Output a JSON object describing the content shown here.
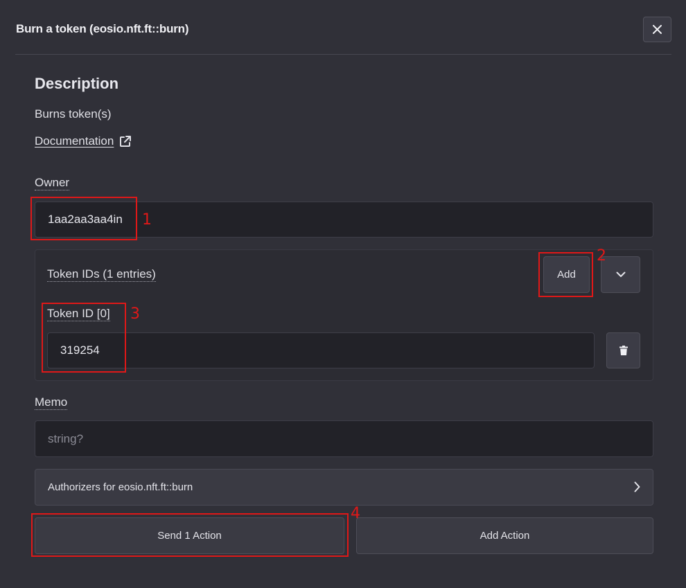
{
  "dialog": {
    "title": "Burn a token (eosio.nft.ft::burn)"
  },
  "description": {
    "heading": "Description",
    "text": "Burns token(s)",
    "doc_link": "Documentation"
  },
  "owner": {
    "label": "Owner",
    "value": "1aa2aa3aa4in"
  },
  "token_ids": {
    "label": "Token IDs (1 entries)",
    "add_label": "Add",
    "items": [
      {
        "label": "Token ID [0]",
        "value": "319254"
      }
    ]
  },
  "memo": {
    "label": "Memo",
    "placeholder": "string?"
  },
  "authorizers": {
    "label": "Authorizers for eosio.nft.ft::burn"
  },
  "footer": {
    "send_label": "Send 1 Action",
    "add_action_label": "Add Action"
  },
  "annotations": [
    "1",
    "2",
    "3",
    "4"
  ],
  "colors": {
    "annotation": "#e01818",
    "background": "#303038",
    "input_bg": "#222228"
  }
}
